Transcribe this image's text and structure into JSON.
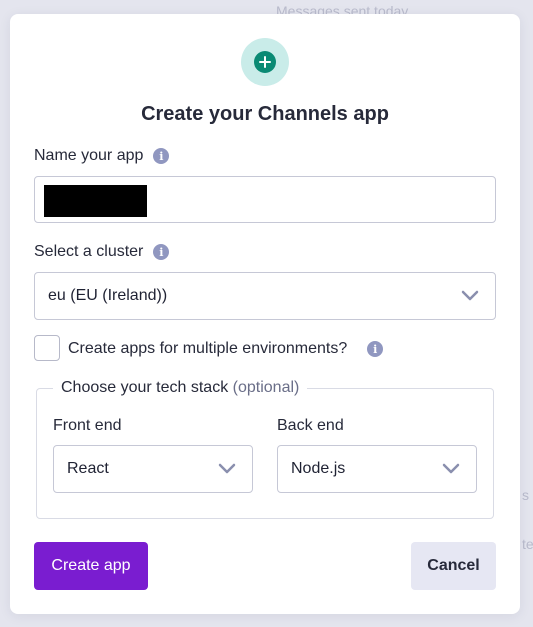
{
  "background": {
    "top_text": "Messages sent today",
    "right_text_1": "s",
    "right_text_2": "te"
  },
  "modal": {
    "title": "Create your Channels app",
    "name_field": {
      "label": "Name your app",
      "value": ""
    },
    "cluster": {
      "label": "Select a cluster",
      "selected": "eu (EU (Ireland))"
    },
    "multi_env": {
      "label": "Create apps for multiple environments?",
      "checked": false
    },
    "tech_stack": {
      "legend": "Choose your tech stack",
      "legend_optional": "(optional)",
      "front_end": {
        "label": "Front end",
        "selected": "React"
      },
      "back_end": {
        "label": "Back end",
        "selected": "Node.js"
      }
    },
    "buttons": {
      "create": "Create app",
      "cancel": "Cancel"
    }
  },
  "icons": {
    "add": "plus-circle-icon",
    "info": "info-icon",
    "dropdown": "chevron-down-icon"
  },
  "colors": {
    "primary": "#7a1dd0",
    "accent_teal": "#0a8a74",
    "accent_teal_light": "#c9ece9",
    "info": "#9097c0"
  }
}
